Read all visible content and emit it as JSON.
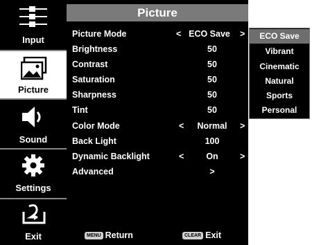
{
  "nav": {
    "items": [
      {
        "label": "Input",
        "icon": "input-cables-icon"
      },
      {
        "label": "Picture",
        "icon": "picture-icon"
      },
      {
        "label": "Sound",
        "icon": "speaker-icon"
      },
      {
        "label": "Settings",
        "icon": "gear-icon"
      },
      {
        "label": "Exit",
        "icon": "exit-icon"
      }
    ],
    "active": "Picture"
  },
  "panel": {
    "title": "Picture",
    "rows": [
      {
        "label": "Picture Mode",
        "value": "ECO Save",
        "left_arrow": "<",
        "right_arrow": ">"
      },
      {
        "label": "Brightness",
        "value": "50"
      },
      {
        "label": "Contrast",
        "value": "50"
      },
      {
        "label": "Saturation",
        "value": "50"
      },
      {
        "label": "Sharpness",
        "value": "50"
      },
      {
        "label": "Tint",
        "value": "50"
      },
      {
        "label": "Color Mode",
        "value": "Normal",
        "left_arrow": "<",
        "right_arrow": ">"
      },
      {
        "label": "Back Light",
        "value": "100"
      },
      {
        "label": "Dynamic Backlight",
        "value": "On",
        "left_arrow": "<",
        "right_arrow": ">"
      },
      {
        "label": "Advanced",
        "value": ">"
      }
    ],
    "footer": {
      "return_key": "MENU",
      "return_label": "Return",
      "exit_key": "CLEAR",
      "exit_label": "Exit"
    }
  },
  "dropdown": {
    "options": [
      "ECO Save",
      "Vibrant",
      "Cinematic",
      "Natural",
      "Sports",
      "Personal"
    ],
    "selected": "ECO Save"
  },
  "colors": {
    "background": "#000000",
    "header": "#7a7a7a",
    "selected": "#6e6e6e",
    "text": "#ffffff"
  }
}
